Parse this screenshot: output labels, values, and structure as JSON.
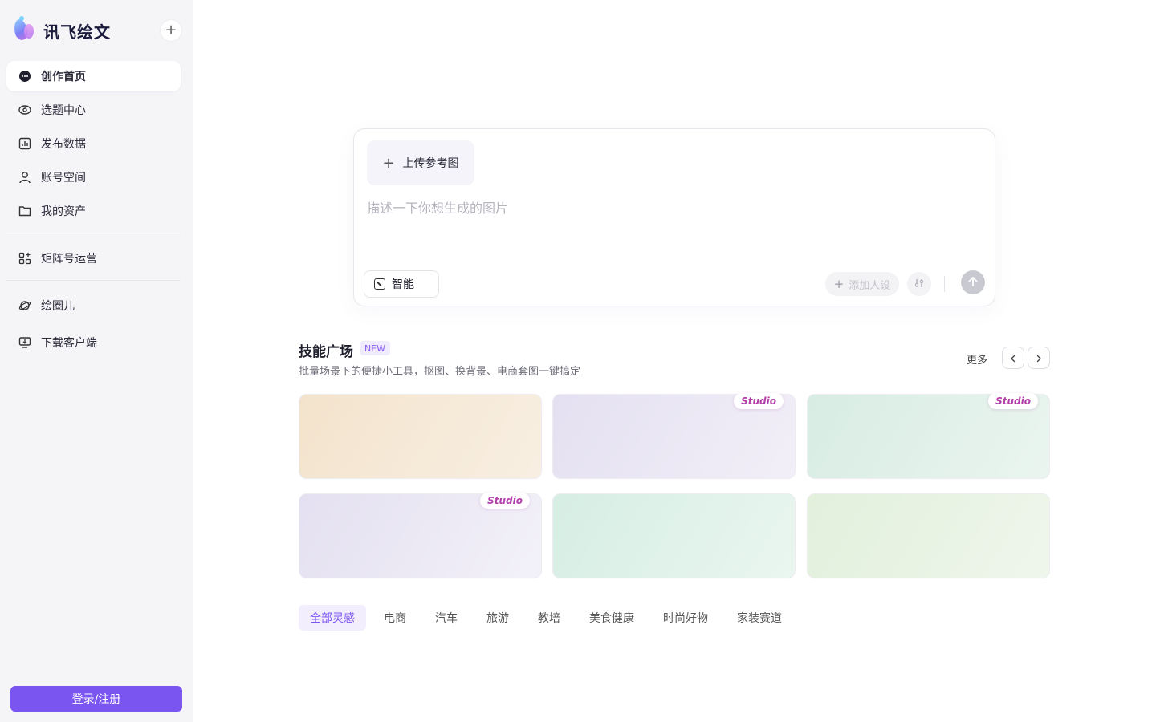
{
  "sidebar": {
    "brand": "讯飞绘文",
    "new_icon": "plus-icon",
    "items": [
      {
        "label": "创作首页",
        "icon": "chat-bubble-icon",
        "active": true
      },
      {
        "label": "选题中心",
        "icon": "eye-target-icon"
      },
      {
        "label": "发布数据",
        "icon": "bar-chart-icon"
      },
      {
        "label": "账号空间",
        "icon": "user-icon"
      },
      {
        "label": "我的资产",
        "icon": "folder-icon"
      },
      {
        "label": "矩阵号运营",
        "icon": "grid-sparkle-icon"
      },
      {
        "label": "绘圈儿",
        "icon": "planet-icon"
      },
      {
        "label": "下载客户端",
        "icon": "monitor-download-icon"
      }
    ],
    "login_label": "登录/注册"
  },
  "prompt": {
    "upload_label": "上传参考图",
    "placeholder": "描述一下你想生成的图片",
    "mode_label": "智能",
    "add_persona_label": "添加人设"
  },
  "skills": {
    "title": "技能广场",
    "badge": "NEW",
    "subtitle": "批量场景下的便捷小工具，抠图、换背景、电商套图一键搞定",
    "more_label": "更多",
    "studio_label": "Studio",
    "cards": [
      {
        "studio": false,
        "gradient": [
          "#f3e3cc",
          "#f8efe2"
        ]
      },
      {
        "studio": true,
        "gradient": [
          "#e4e0f1",
          "#f2eff8"
        ]
      },
      {
        "studio": true,
        "gradient": [
          "#d8ece3",
          "#eaf5ef"
        ]
      },
      {
        "studio": true,
        "gradient": [
          "#e4e0f1",
          "#f3f1f8"
        ]
      },
      {
        "studio": false,
        "gradient": [
          "#d6eee4",
          "#eaf6f0"
        ]
      },
      {
        "studio": false,
        "gradient": [
          "#e2f0dc",
          "#eff6ec"
        ]
      }
    ]
  },
  "categories": {
    "items": [
      "全部灵感",
      "电商",
      "汽车",
      "旅游",
      "教培",
      "美食健康",
      "时尚好物",
      "家装赛道"
    ],
    "active_index": 0
  },
  "colors": {
    "accent": "#7b55f0",
    "studio_text": "#b23fa9"
  }
}
